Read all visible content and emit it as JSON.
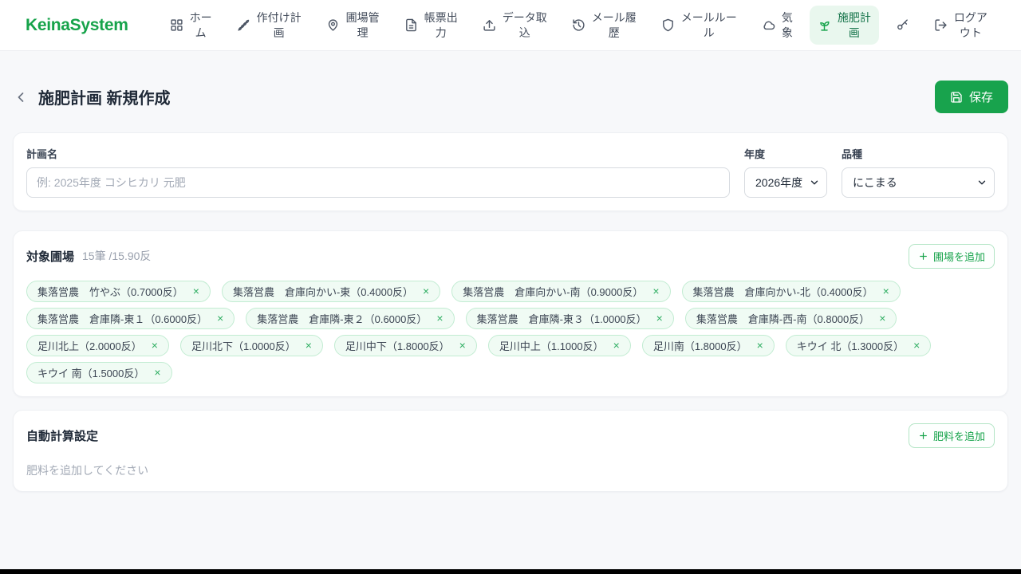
{
  "navbar": {
    "logo": "KeinaSystem",
    "items": [
      {
        "label": "ホー\nム",
        "icon": "grid-icon",
        "active": false
      },
      {
        "label": "作付け計\n画",
        "icon": "wheat-icon",
        "active": false
      },
      {
        "label": "圃場管\n理",
        "icon": "map-pin-icon",
        "active": false
      },
      {
        "label": "帳票出\n力",
        "icon": "document-icon",
        "active": false
      },
      {
        "label": "データ取\n込",
        "icon": "upload-icon",
        "active": false
      },
      {
        "label": "メール履\n歴",
        "icon": "history-icon",
        "active": false
      },
      {
        "label": "メールルー\nル",
        "icon": "shield-icon",
        "active": false
      },
      {
        "label": "気\n象",
        "icon": "cloud-icon",
        "active": false
      },
      {
        "label": "施肥計\n画",
        "icon": "sprout-icon",
        "active": true
      },
      {
        "label": "",
        "icon": "key-icon",
        "active": false
      },
      {
        "label": "ログア\nウト",
        "icon": "logout-icon",
        "active": false
      }
    ]
  },
  "header": {
    "title": "施肥計画 新規作成",
    "save_label": "保存"
  },
  "plan_form": {
    "name_label": "計画名",
    "name_placeholder": "例: 2025年度 コシヒカリ 元肥",
    "year_label": "年度",
    "year_value": "2026年度",
    "variety_label": "品種",
    "variety_value": "にこまる"
  },
  "fields_section": {
    "title": "対象圃場",
    "summary": "15筆 /15.90反",
    "add_button": "圃場を追加",
    "tags": [
      {
        "label": "集落営農　竹やぶ（0.7000反）"
      },
      {
        "label": "集落営農　倉庫向かい-東（0.4000反）"
      },
      {
        "label": "集落営農　倉庫向かい-南（0.9000反）"
      },
      {
        "label": "集落営農　倉庫向かい-北（0.4000反）"
      },
      {
        "label": "集落営農　倉庫隣-東１（0.6000反）"
      },
      {
        "label": "集落営農　倉庫隣-東２（0.6000反）"
      },
      {
        "label": "集落営農　倉庫隣-東３（1.0000反）"
      },
      {
        "label": "集落営農　倉庫隣-西-南（0.8000反）"
      },
      {
        "label": "足川北上（2.0000反）"
      },
      {
        "label": "足川北下（1.0000反）"
      },
      {
        "label": "足川中下（1.8000反）"
      },
      {
        "label": "足川中上（1.1000反）"
      },
      {
        "label": "足川南（1.8000反）"
      },
      {
        "label": "キウイ 北（1.3000反）"
      },
      {
        "label": "キウイ 南（1.5000反）"
      }
    ]
  },
  "fertilizer_section": {
    "title": "自動計算設定",
    "add_button": "肥料を追加",
    "empty_text": "肥料を追加してください"
  },
  "glyphs": {
    "close": "×"
  },
  "colors": {
    "accent_green": "#16a34a",
    "active_nav_bg": "#e9f7ee",
    "tag_bg": "#f0fbf4",
    "tag_border": "#c2ecd2",
    "save_button_bg": "#18a34d"
  }
}
